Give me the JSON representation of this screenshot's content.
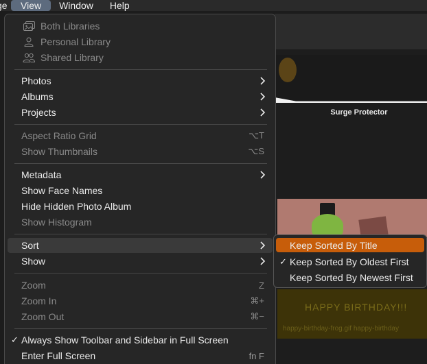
{
  "menubar": {
    "items": [
      {
        "label": "ge"
      },
      {
        "label": "View"
      },
      {
        "label": "Window"
      },
      {
        "label": "Help"
      }
    ]
  },
  "background": {
    "thumb1_caption": "Surge Protector",
    "thumb3_text": "HAPPY BIRTHDAY!!!",
    "thumb3_caption": "happy-birthday-frog.gif happy-birthday"
  },
  "view_menu": {
    "both_libraries": "Both Libraries",
    "personal_library": "Personal Library",
    "shared_library": "Shared Library",
    "photos": "Photos",
    "albums": "Albums",
    "projects": "Projects",
    "aspect_ratio_grid": "Aspect Ratio Grid",
    "aspect_ratio_grid_shortcut": "⌥T",
    "show_thumbnails": "Show Thumbnails",
    "show_thumbnails_shortcut": "⌥S",
    "metadata": "Metadata",
    "show_face_names": "Show Face Names",
    "hide_hidden_album": "Hide Hidden Photo Album",
    "show_histogram": "Show Histogram",
    "sort": "Sort",
    "show": "Show",
    "zoom": "Zoom",
    "zoom_shortcut": "Z",
    "zoom_in": "Zoom In",
    "zoom_in_shortcut": "⌘+",
    "zoom_out": "Zoom Out",
    "zoom_out_shortcut": "⌘−",
    "always_show_toolbar": "Always Show Toolbar and Sidebar in Full Screen",
    "enter_full_screen": "Enter Full Screen",
    "enter_full_screen_shortcut": "fn F",
    "checkmark": "✓"
  },
  "sort_submenu": {
    "by_title": "Keep Sorted By Title",
    "by_oldest": "Keep Sorted By Oldest First",
    "by_newest": "Keep Sorted By Newest First",
    "checkmark": "✓"
  },
  "colors": {
    "accent": "#c75d0a",
    "menu_bg": "#262626",
    "highlight": "#3a3a3a",
    "active_menubar": "#5d6b7e"
  }
}
